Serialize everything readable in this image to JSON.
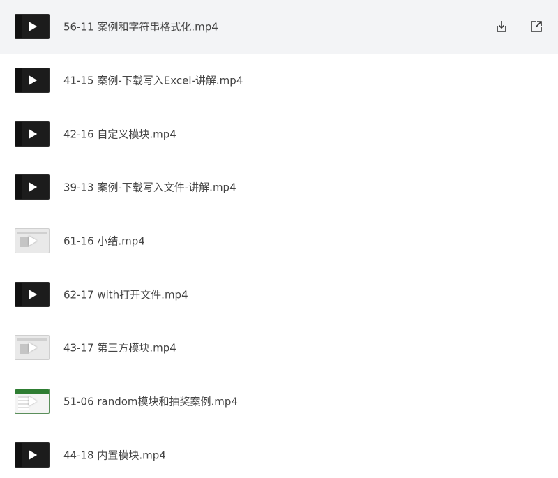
{
  "files": [
    {
      "name": "56-11 案例和字符串格式化.mp4",
      "thumb": "dark",
      "hovered": true
    },
    {
      "name": "41-15 案例-下载写入Excel-讲解.mp4",
      "thumb": "dark",
      "hovered": false
    },
    {
      "name": "42-16 自定义模块.mp4",
      "thumb": "dark",
      "hovered": false
    },
    {
      "name": "39-13 案例-下载写入文件-讲解.mp4",
      "thumb": "dark",
      "hovered": false
    },
    {
      "name": "61-16 小结.mp4",
      "thumb": "light",
      "hovered": false
    },
    {
      "name": "62-17 with打开文件.mp4",
      "thumb": "dark",
      "hovered": false
    },
    {
      "name": "43-17 第三方模块.mp4",
      "thumb": "light",
      "hovered": false
    },
    {
      "name": "51-06 random模块和抽奖案例.mp4",
      "thumb": "green",
      "hovered": false
    },
    {
      "name": "44-18 内置模块.mp4",
      "thumb": "dark",
      "hovered": false
    }
  ],
  "actions": {
    "download_icon": "download-icon",
    "open_external_icon": "open-external-icon"
  },
  "colors": {
    "hover_background": "#f3f4f6",
    "text": "#444444",
    "icon": "#333333"
  }
}
